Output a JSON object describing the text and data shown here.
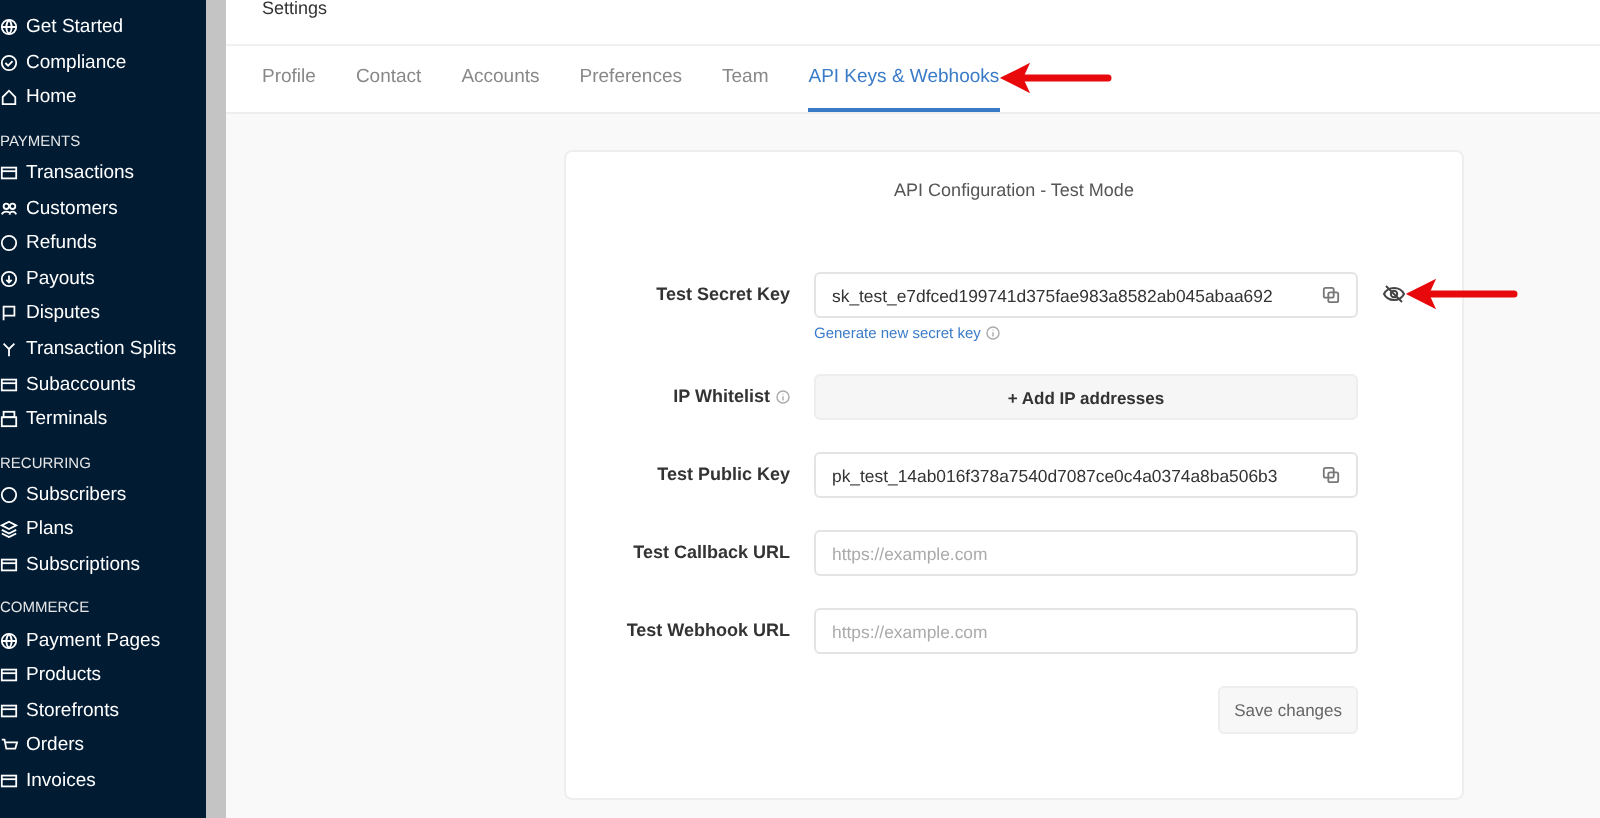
{
  "sidebar": {
    "sections": [
      {
        "items": [
          {
            "label": "Get Started"
          },
          {
            "label": "Compliance"
          },
          {
            "label": "Home"
          }
        ]
      },
      {
        "heading": "PAYMENTS",
        "items": [
          {
            "label": "Transactions"
          },
          {
            "label": "Customers"
          },
          {
            "label": "Refunds"
          },
          {
            "label": "Payouts"
          },
          {
            "label": "Disputes"
          },
          {
            "label": "Transaction Splits"
          },
          {
            "label": "Subaccounts"
          },
          {
            "label": "Terminals"
          }
        ]
      },
      {
        "heading": "RECURRING",
        "items": [
          {
            "label": "Subscribers"
          },
          {
            "label": "Plans"
          },
          {
            "label": "Subscriptions"
          }
        ]
      },
      {
        "heading": "COMMERCE",
        "items": [
          {
            "label": "Payment Pages"
          },
          {
            "label": "Products"
          },
          {
            "label": "Storefronts"
          },
          {
            "label": "Orders"
          },
          {
            "label": "Invoices"
          }
        ]
      }
    ]
  },
  "page": {
    "title": "Settings"
  },
  "tabs": [
    {
      "label": "Profile",
      "selected": false
    },
    {
      "label": "Contact",
      "selected": false
    },
    {
      "label": "Accounts",
      "selected": false
    },
    {
      "label": "Preferences",
      "selected": false
    },
    {
      "label": "Team",
      "selected": false
    },
    {
      "label": "API Keys & Webhooks",
      "selected": true
    }
  ],
  "card": {
    "title": "API Configuration - Test Mode",
    "fields": [
      {
        "kind": "key",
        "label": "Test Secret Key",
        "value": "sk_test_e7dfced199741d375fae983a8582ab045abaa692",
        "link": "Generate new secret key",
        "toggle": true
      },
      {
        "kind": "add",
        "label": "IP Whitelist",
        "info": true,
        "button": "+ Add IP addresses"
      },
      {
        "kind": "key",
        "label": "Test Public Key",
        "value": "pk_test_14ab016f378a7540d7087ce0c4a0374a8ba506b3"
      },
      {
        "kind": "url",
        "label": "Test Callback URL",
        "placeholder": "https://example.com"
      },
      {
        "kind": "url",
        "label": "Test Webhook URL",
        "placeholder": "https://example.com"
      }
    ],
    "save": "Save changes"
  }
}
